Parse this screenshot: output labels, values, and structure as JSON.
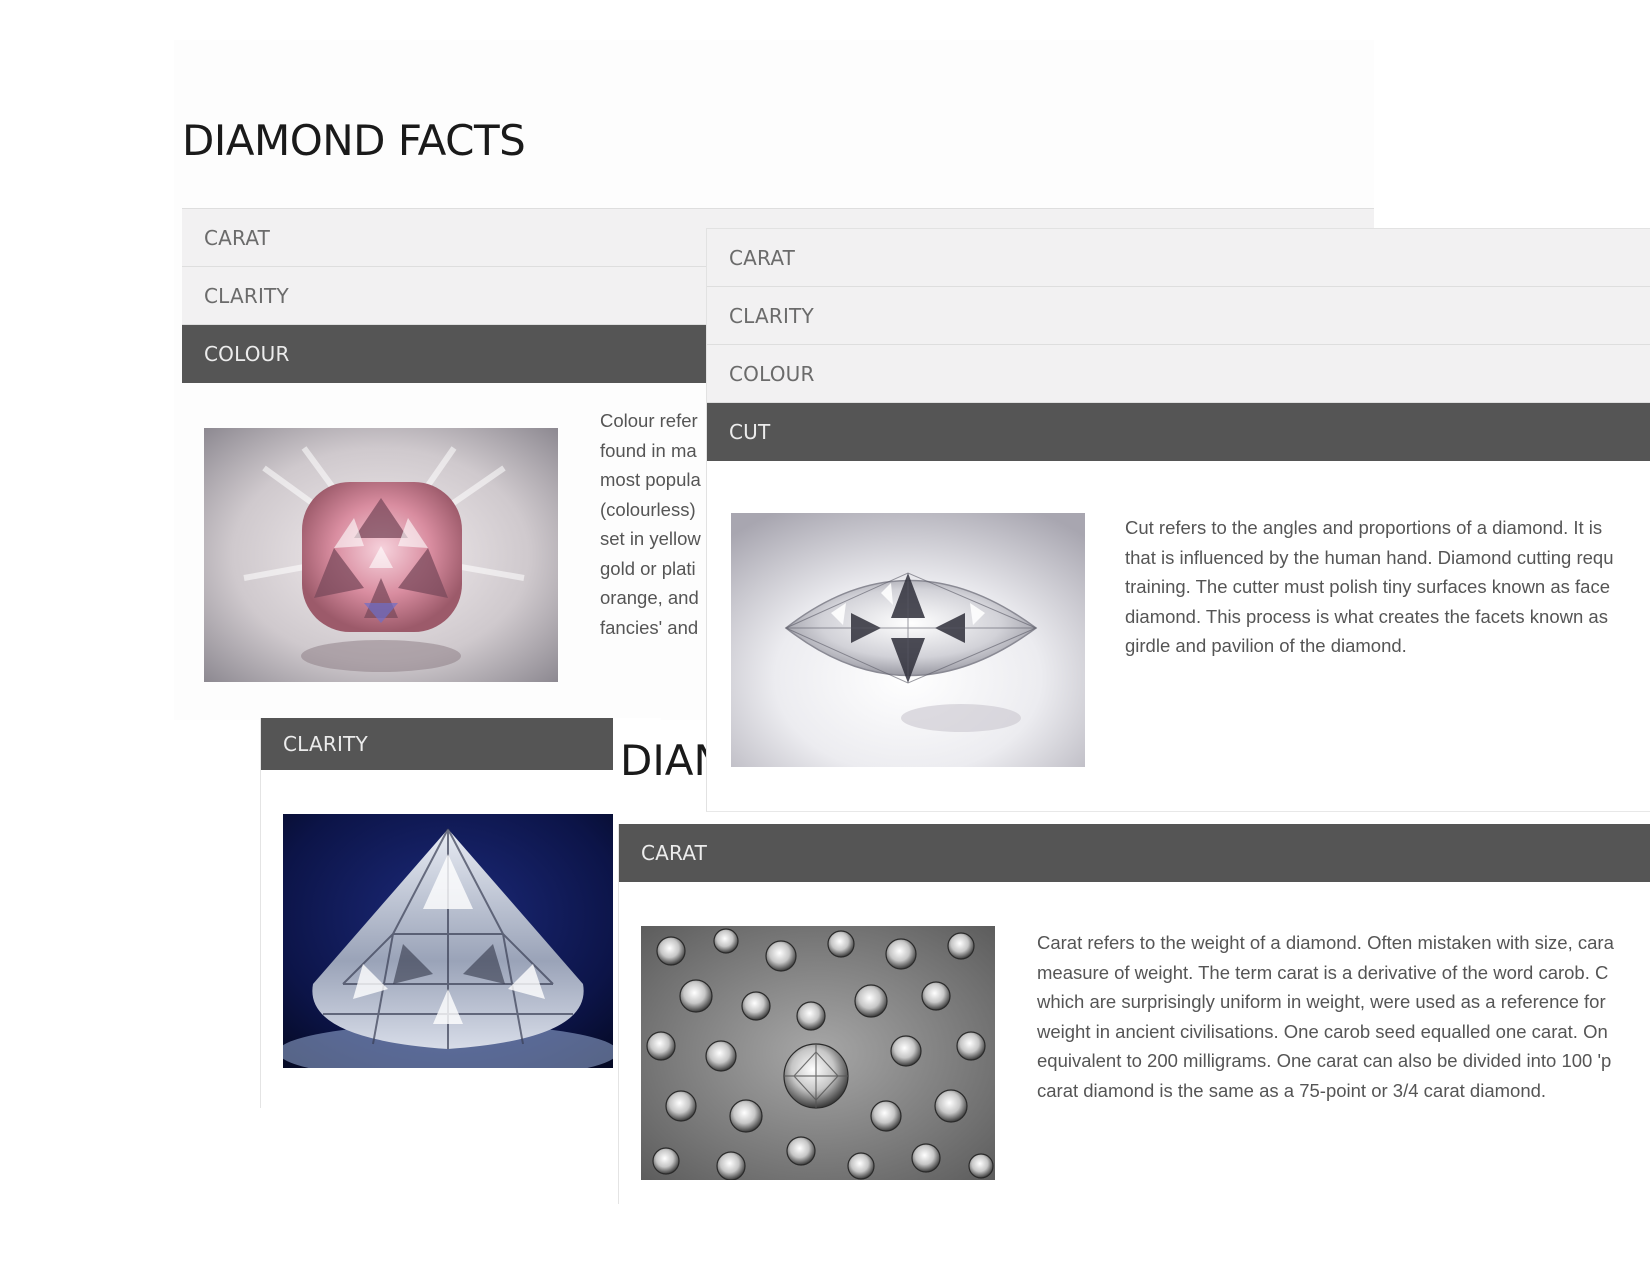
{
  "panel_colour": {
    "title": "DIAMOND FACTS",
    "items": [
      "CARAT",
      "CLARITY",
      "COLOUR"
    ],
    "active": "COLOUR",
    "text_lines": [
      "Colour refer",
      "found in ma",
      "most popula",
      "(colourless)",
      "set in yellow",
      "gold or plati",
      "orange, and",
      "fancies' and"
    ]
  },
  "panel_clarity": {
    "header": "CLARITY",
    "title_fragment": "DIAN"
  },
  "panel_cut": {
    "items": [
      "CARAT",
      "CLARITY",
      "COLOUR",
      "CUT"
    ],
    "active": "CUT",
    "text_lines": [
      "Cut refers to the angles and proportions of a diamond. It is",
      "that is influenced by the human hand. Diamond cutting requ",
      "training. The cutter must polish tiny surfaces known as face",
      "diamond. This process is what creates the facets known as",
      "girdle and pavilion of the diamond."
    ]
  },
  "panel_carat": {
    "header": "CARAT",
    "text_lines": [
      "Carat refers to the weight of a diamond. Often mistaken with size, cara",
      "measure of weight. The term carat is a derivative of the word carob. C",
      "which are surprisingly uniform in weight, were used as a reference for",
      "weight in ancient civilisations. One carob seed equalled one carat. On",
      "equivalent to 200 milligrams. One carat can also be divided into 100 'p",
      "carat diamond is the same as a 75-point or 3/4 carat diamond."
    ]
  }
}
